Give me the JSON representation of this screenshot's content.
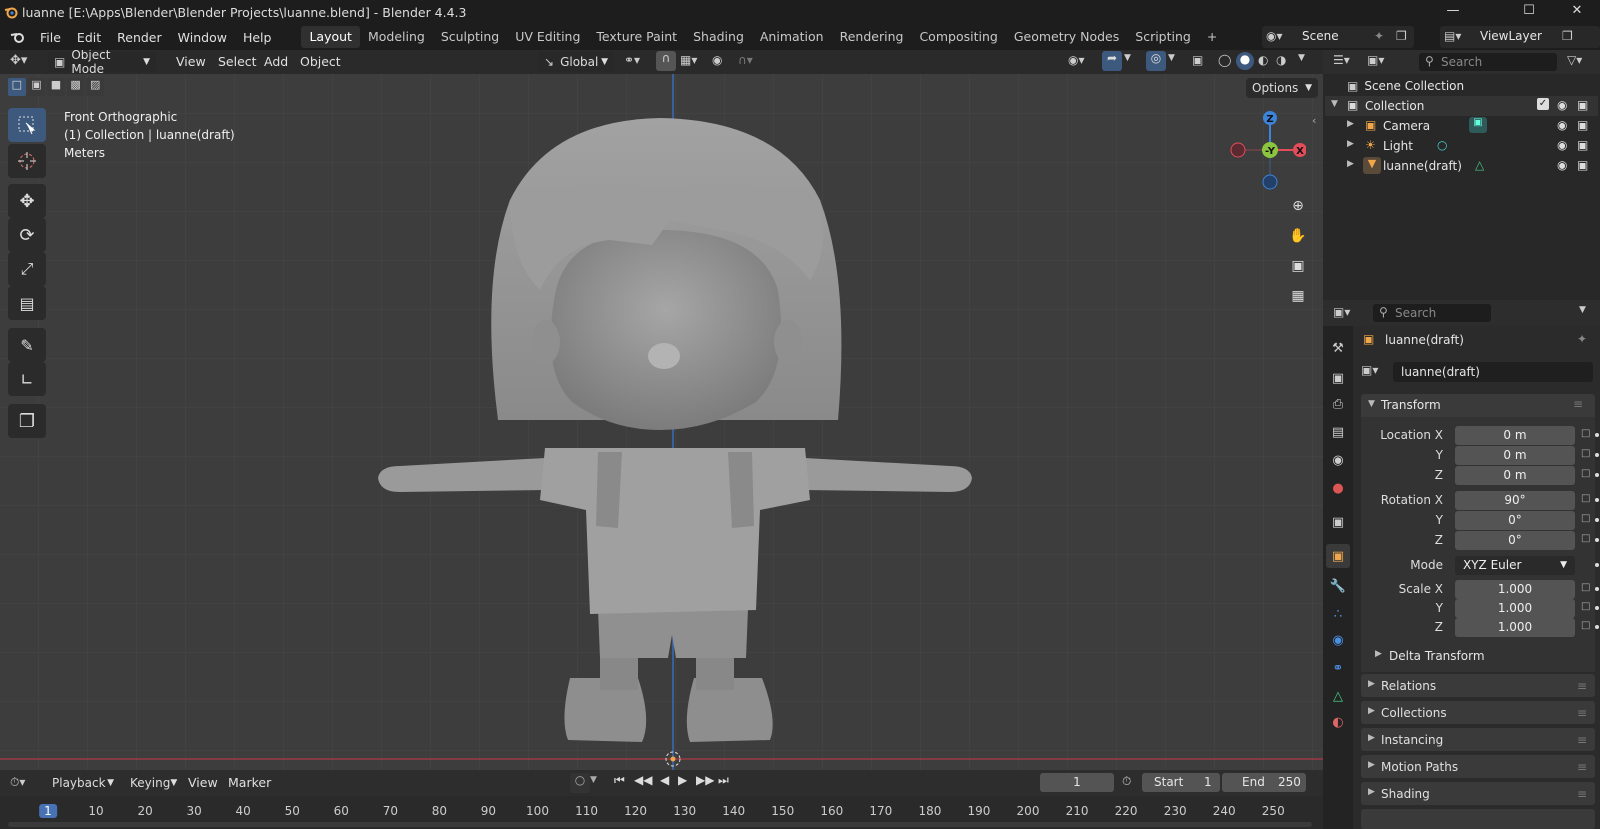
{
  "window": {
    "title": "luanne [E:\\Apps\\Blender\\Blender Projects\\luanne.blend] - Blender 4.4.3"
  },
  "menus": [
    "File",
    "Edit",
    "Render",
    "Window",
    "Help"
  ],
  "workspaces": [
    "Layout",
    "Modeling",
    "Sculpting",
    "UV Editing",
    "Texture Paint",
    "Shading",
    "Animation",
    "Rendering",
    "Compositing",
    "Geometry Nodes",
    "Scripting"
  ],
  "active_workspace": "Layout",
  "add_workspace": "+",
  "scene": {
    "name": "Scene",
    "view_layer": "ViewLayer"
  },
  "viewport": {
    "mode": "Object Mode",
    "menus": [
      "View",
      "Select",
      "Add",
      "Object"
    ],
    "transform_orientation": "Global",
    "options_label": "Options",
    "info_view": "Front Orthographic",
    "info_collection": "(1) Collection | luanne(draft)",
    "info_units": "Meters",
    "gizmo": {
      "z": "Z",
      "y": "-Y",
      "x": "X"
    }
  },
  "outliner": {
    "search_placeholder": "Search",
    "root": "Scene Collection",
    "collection": "Collection",
    "items": [
      "Camera",
      "Light",
      "luanne(draft)"
    ]
  },
  "properties": {
    "search_placeholder": "Search",
    "object_name": "luanne(draft)",
    "data_name": "luanne(draft)",
    "transform": {
      "title": "Transform",
      "location_label": "Location X",
      "location": [
        "0 m",
        "0 m",
        "0 m"
      ],
      "rotation_label": "Rotation X",
      "rotation": [
        "90°",
        "0°",
        "0°"
      ],
      "mode_label": "Mode",
      "mode": "XYZ Euler",
      "scale_label": "Scale X",
      "scale": [
        "1.000",
        "1.000",
        "1.000"
      ],
      "y": "Y",
      "z": "Z",
      "delta": "Delta Transform"
    },
    "panels": [
      "Relations",
      "Collections",
      "Instancing",
      "Motion Paths",
      "Shading"
    ]
  },
  "timeline": {
    "menus": [
      "Playback",
      "Keying",
      "View",
      "Marker"
    ],
    "current_frame": "1",
    "start_label": "Start",
    "start": "1",
    "end_label": "End",
    "end": "250",
    "ticks": [
      "1",
      "10",
      "20",
      "30",
      "40",
      "50",
      "60",
      "70",
      "80",
      "90",
      "100",
      "110",
      "120",
      "130",
      "140",
      "150",
      "160",
      "170",
      "180",
      "190",
      "200",
      "210",
      "220",
      "230",
      "240",
      "250"
    ]
  },
  "colors": {
    "accent": "#4772b3",
    "x_axis": "#e34d5a",
    "y_axis": "#8bc53f",
    "z_axis": "#3b84d9",
    "bg": "#303030"
  }
}
